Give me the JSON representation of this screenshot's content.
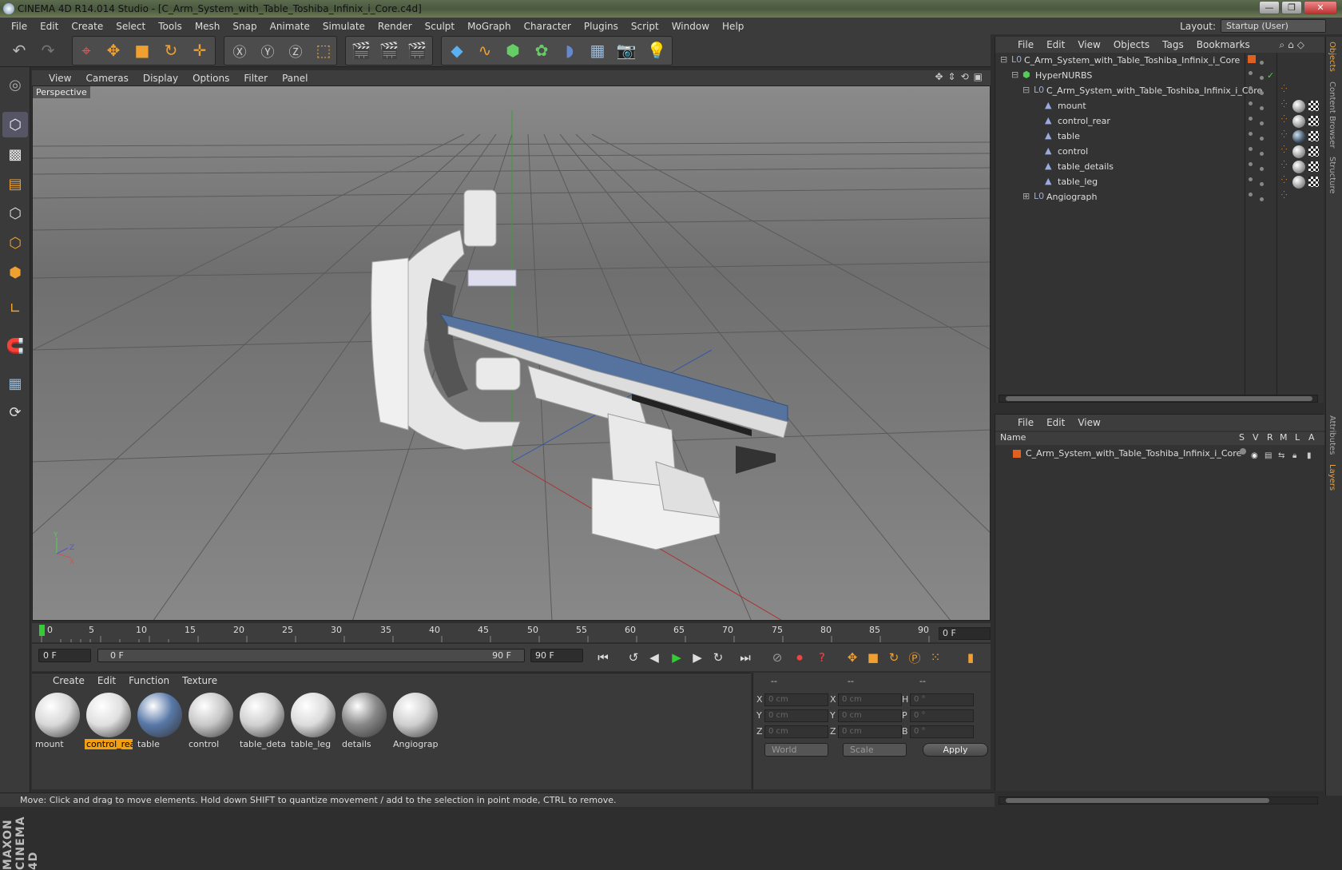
{
  "window": {
    "title": "CINEMA 4D R14.014 Studio - [C_Arm_System_with_Table_Toshiba_Infinix_i_Core.c4d]",
    "minimize": "—",
    "maximize": "❐",
    "close": "✕"
  },
  "menu": [
    "File",
    "Edit",
    "Create",
    "Select",
    "Tools",
    "Mesh",
    "Snap",
    "Animate",
    "Simulate",
    "Render",
    "Sculpt",
    "MoGraph",
    "Character",
    "Plugins",
    "Script",
    "Window",
    "Help"
  ],
  "layout": {
    "label": "Layout:",
    "value": "Startup (User)"
  },
  "viewport": {
    "menu": [
      "View",
      "Cameras",
      "Display",
      "Options",
      "Filter",
      "Panel"
    ],
    "label": "Perspective",
    "axis_labels": {
      "x": "X",
      "y": "Y",
      "z": "Z"
    }
  },
  "timeline": {
    "ticks": [
      "0",
      "5",
      "10",
      "15",
      "20",
      "25",
      "30",
      "35",
      "40",
      "45",
      "50",
      "55",
      "60",
      "65",
      "70",
      "75",
      "80",
      "85",
      "90"
    ],
    "current_frame": "0 F"
  },
  "transport": {
    "start": "0 F",
    "range_start": "0 F",
    "range_end": "90 F",
    "end": "90 F"
  },
  "materials": {
    "menu": [
      "Create",
      "Edit",
      "Function",
      "Texture"
    ],
    "items": [
      {
        "name": "mount",
        "color": "#d8d8d8",
        "selected": false
      },
      {
        "name": "control_rea",
        "color": "#e0e0e0",
        "selected": true
      },
      {
        "name": "table",
        "color": "#5878a8",
        "selected": false
      },
      {
        "name": "control",
        "color": "#c8c8c8",
        "selected": false
      },
      {
        "name": "table_detai",
        "color": "#d0d0d0",
        "selected": false
      },
      {
        "name": "table_leg",
        "color": "#dcdcdc",
        "selected": false
      },
      {
        "name": "details",
        "color": "#888",
        "selected": false
      },
      {
        "name": "Angiograp",
        "color": "#cfcfcf",
        "selected": false
      }
    ]
  },
  "coords": {
    "header": [
      "--",
      "--",
      "--"
    ],
    "rows": [
      {
        "a": "X",
        "av": "0 cm",
        "b": "X",
        "bv": "0 cm",
        "c": "H",
        "cv": "0 °"
      },
      {
        "a": "Y",
        "av": "0 cm",
        "b": "Y",
        "bv": "0 cm",
        "c": "P",
        "cv": "0 °"
      },
      {
        "a": "Z",
        "av": "0 cm",
        "b": "Z",
        "bv": "0 cm",
        "c": "B",
        "cv": "0 °"
      }
    ],
    "world": "World",
    "scale": "Scale",
    "apply": "Apply"
  },
  "status": "Move: Click and drag to move elements. Hold down SHIFT to quantize movement / add to the selection in point mode, CTRL to remove.",
  "objects": {
    "menu": [
      "File",
      "Edit",
      "View",
      "Objects",
      "Tags",
      "Bookmarks"
    ],
    "rows": [
      {
        "name": "C_Arm_System_with_Table_Toshiba_Infinix_i_Core",
        "indent": 0
      },
      {
        "name": "HyperNURBS",
        "indent": 1
      },
      {
        "name": "C_Arm_System_with_Table_Toshiba_Infinix_i_Core",
        "indent": 2
      },
      {
        "name": "mount",
        "indent": 3
      },
      {
        "name": "control_rear",
        "indent": 3
      },
      {
        "name": "table",
        "indent": 3
      },
      {
        "name": "control",
        "indent": 3
      },
      {
        "name": "table_details",
        "indent": 3
      },
      {
        "name": "table_leg",
        "indent": 3
      },
      {
        "name": "Angiograph",
        "indent": 2
      }
    ]
  },
  "layers": {
    "menu": [
      "File",
      "Edit",
      "View"
    ],
    "columns": [
      "Name",
      "S",
      "V",
      "R",
      "M",
      "L",
      "A"
    ],
    "row": "C_Arm_System_with_Table_Toshiba_Infinix_i_Core"
  },
  "right_tabs": [
    "Objects",
    "Content Browser",
    "Structure",
    "Attributes",
    "Layers"
  ],
  "maxon": "MAXON CINEMA 4D"
}
